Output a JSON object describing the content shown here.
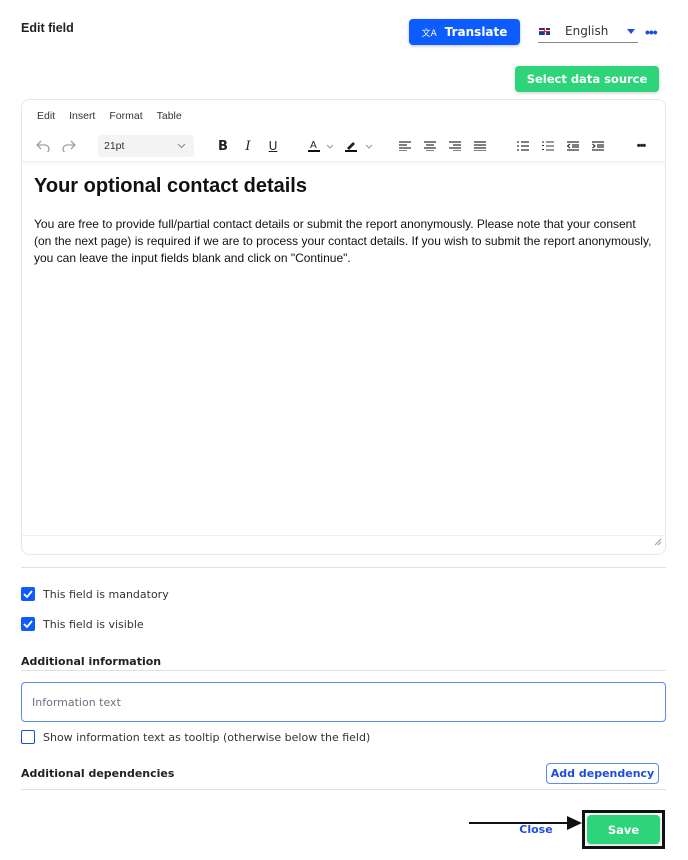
{
  "dialog": {
    "title": "Edit field"
  },
  "header": {
    "translate_label": "Translate",
    "translate_icon": "translate-icon",
    "language": {
      "selected": "English",
      "flag": "uk-flag-icon"
    },
    "more_icon": "more-horizontal-icon",
    "select_data_source_label": "Select data source"
  },
  "editor": {
    "menu": [
      "Edit",
      "Insert",
      "Format",
      "Table"
    ],
    "toolbar": {
      "undo_icon": "undo-icon",
      "redo_icon": "redo-icon",
      "font_size": "21pt",
      "bold": "B",
      "italic": "I",
      "underline": "U",
      "text_color_icon": "text-color-icon",
      "highlight_icon": "highlight-icon",
      "align_icons": [
        "align-left-icon",
        "align-center-icon",
        "align-right-icon",
        "align-justify-icon"
      ],
      "list_icons": [
        "bullet-list-icon",
        "numbered-list-icon",
        "outdent-icon",
        "indent-icon"
      ],
      "more_icon": "more-horizontal-icon"
    },
    "content": {
      "heading": "Your optional contact details",
      "paragraph": "You are free to provide full/partial contact details or submit the report anonymously. Please note that your consent (on the next page) is required if we are to process your contact details. If you wish to submit the report anonymously, you can leave the input fields blank and click on \"Continue\"."
    }
  },
  "options": {
    "mandatory": {
      "label": "This field is mandatory",
      "checked": true
    },
    "visible": {
      "label": "This field is visible",
      "checked": true
    }
  },
  "additional_information": {
    "heading": "Additional information",
    "input_placeholder": "Information text",
    "input_value": "",
    "tooltip_option": {
      "label": "Show information text as tooltip (otherwise below the field)",
      "checked": false
    }
  },
  "additional_dependencies": {
    "heading": "Additional dependencies",
    "add_label": "Add dependency"
  },
  "footer": {
    "close_label": "Close",
    "save_label": "Save"
  },
  "colors": {
    "primary_blue": "#0d5cff",
    "link_blue": "#1d4ed8",
    "success_green": "#2ed47a"
  }
}
